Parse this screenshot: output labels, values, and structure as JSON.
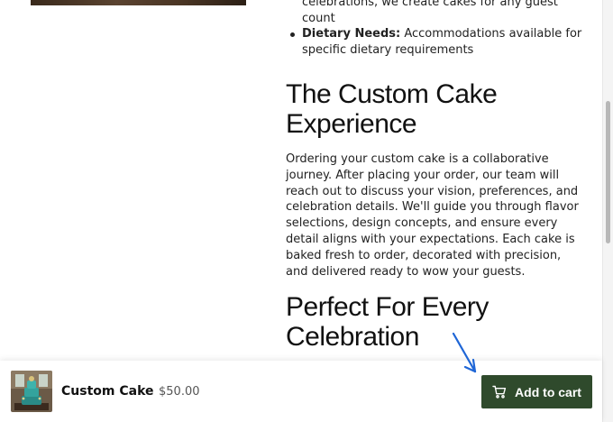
{
  "bullets": [
    {
      "bold": "",
      "text": "celebrations, we create cakes for any guest count"
    },
    {
      "bold": "Dietary Needs:",
      "text": " Accommodations available for specific dietary requirements"
    }
  ],
  "section_experience": {
    "title": "The Custom Cake Experience",
    "paragraph": "Ordering your custom cake is a collaborative journey. After placing your order, our team will reach out to discuss your vision, preferences, and celebration details. We'll guide you through flavor selections, design concepts, and ensure every detail aligns with your expectations. Each cake is baked fresh to order, decorated with precision, and delivered ready to wow your guests."
  },
  "section_celebration": {
    "title": "Perfect For Every Celebration"
  },
  "sticky_cart": {
    "product_name": "Custom Cake",
    "price": "$50.00",
    "add_to_cart_label": "Add to cart",
    "button_color": "#2f4a2c"
  },
  "icons": {
    "cart": "cart-icon",
    "annotation": "arrow-annotation-icon"
  }
}
